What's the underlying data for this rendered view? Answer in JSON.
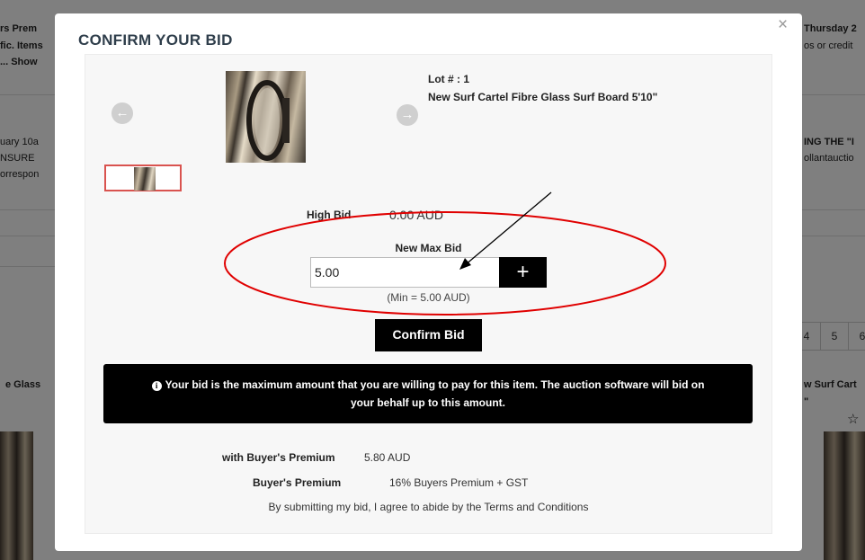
{
  "background": {
    "left_snippets": [
      "rs Prem",
      "fic. Items",
      "... Show",
      "uary 10a",
      "NSURE",
      "orrespon",
      "e Glass"
    ],
    "right_snippets": [
      "Thursday 2",
      "os or credit",
      "ING THE \"I",
      "ollantauctio",
      "w Surf Cart",
      "\""
    ],
    "pagination": [
      "4",
      "5",
      "6"
    ]
  },
  "modal": {
    "title": "CONFIRM YOUR BID",
    "close_glyph": "×",
    "gallery": {
      "prev_glyph": "←",
      "next_glyph": "→"
    },
    "lot": {
      "number_label": "Lot # : 1",
      "title": "New Surf Cartel Fibre Glass Surf Board 5'10\""
    },
    "high_bid": {
      "label": "High Bid",
      "value": "0.00 AUD"
    },
    "new_max_bid": {
      "label": "New Max Bid",
      "value": "5.00",
      "plus_glyph": "+",
      "min_text": "(Min = 5.00 AUD)"
    },
    "confirm_label": "Confirm Bid",
    "info": {
      "icon_glyph": "i",
      "text": "Your bid is the maximum amount that you are willing to pay for this item. The auction software will bid on your behalf up to this amount."
    },
    "with_premium": {
      "label": "with Buyer's Premium",
      "value": "5.80 AUD"
    },
    "premium": {
      "label": "Buyer's Premium",
      "value": "16% Buyers Premium + GST"
    },
    "terms": "By submitting my bid, I agree to abide by the Terms and Conditions"
  },
  "colors": {
    "annotation": "#e00000",
    "thumb_border": "#d9534f",
    "title": "#2f3e4b"
  }
}
